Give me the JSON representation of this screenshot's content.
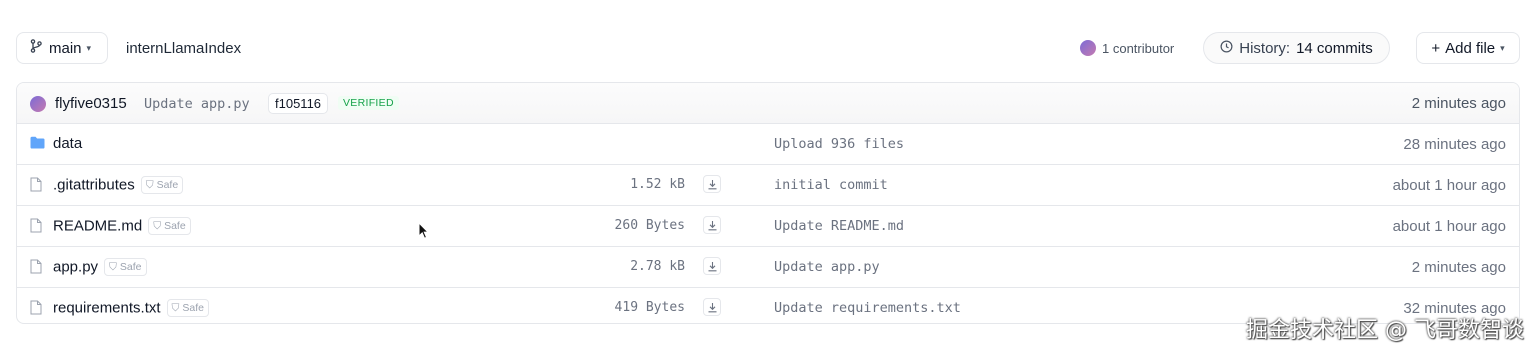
{
  "toolbar": {
    "branch": "main",
    "repo_path": "internLlamaIndex",
    "contributors": "1 contributor",
    "history_label": "History:",
    "history_count": "14 commits",
    "add_file": "Add file"
  },
  "last_commit": {
    "author": "flyfive0315",
    "message": "Update app.py",
    "hash": "f105116",
    "badge": "VERIFIED",
    "time": "2 minutes ago"
  },
  "files": [
    {
      "name": "data",
      "type": "folder",
      "safe": "",
      "size": "",
      "commit": "Upload 936 files",
      "time": "28 minutes ago"
    },
    {
      "name": ".gitattributes",
      "type": "file",
      "safe": "Safe",
      "size": "1.52 kB",
      "commit": "initial commit",
      "time": "about 1 hour ago"
    },
    {
      "name": "README.md",
      "type": "file",
      "safe": "Safe",
      "size": "260 Bytes",
      "commit": "Update README.md",
      "time": "about 1 hour ago"
    },
    {
      "name": "app.py",
      "type": "file",
      "safe": "Safe",
      "size": "2.78 kB",
      "commit": "Update app.py",
      "time": "2 minutes ago"
    },
    {
      "name": "requirements.txt",
      "type": "file",
      "safe": "Safe",
      "size": "419 Bytes",
      "commit": "Update requirements.txt",
      "time": "32 minutes ago"
    }
  ],
  "watermark": "掘金技术社区 @ 飞哥数智谈",
  "colors": {
    "folder": "#60a5fa",
    "verified": "#16a34a",
    "border": "#e5e7eb"
  }
}
